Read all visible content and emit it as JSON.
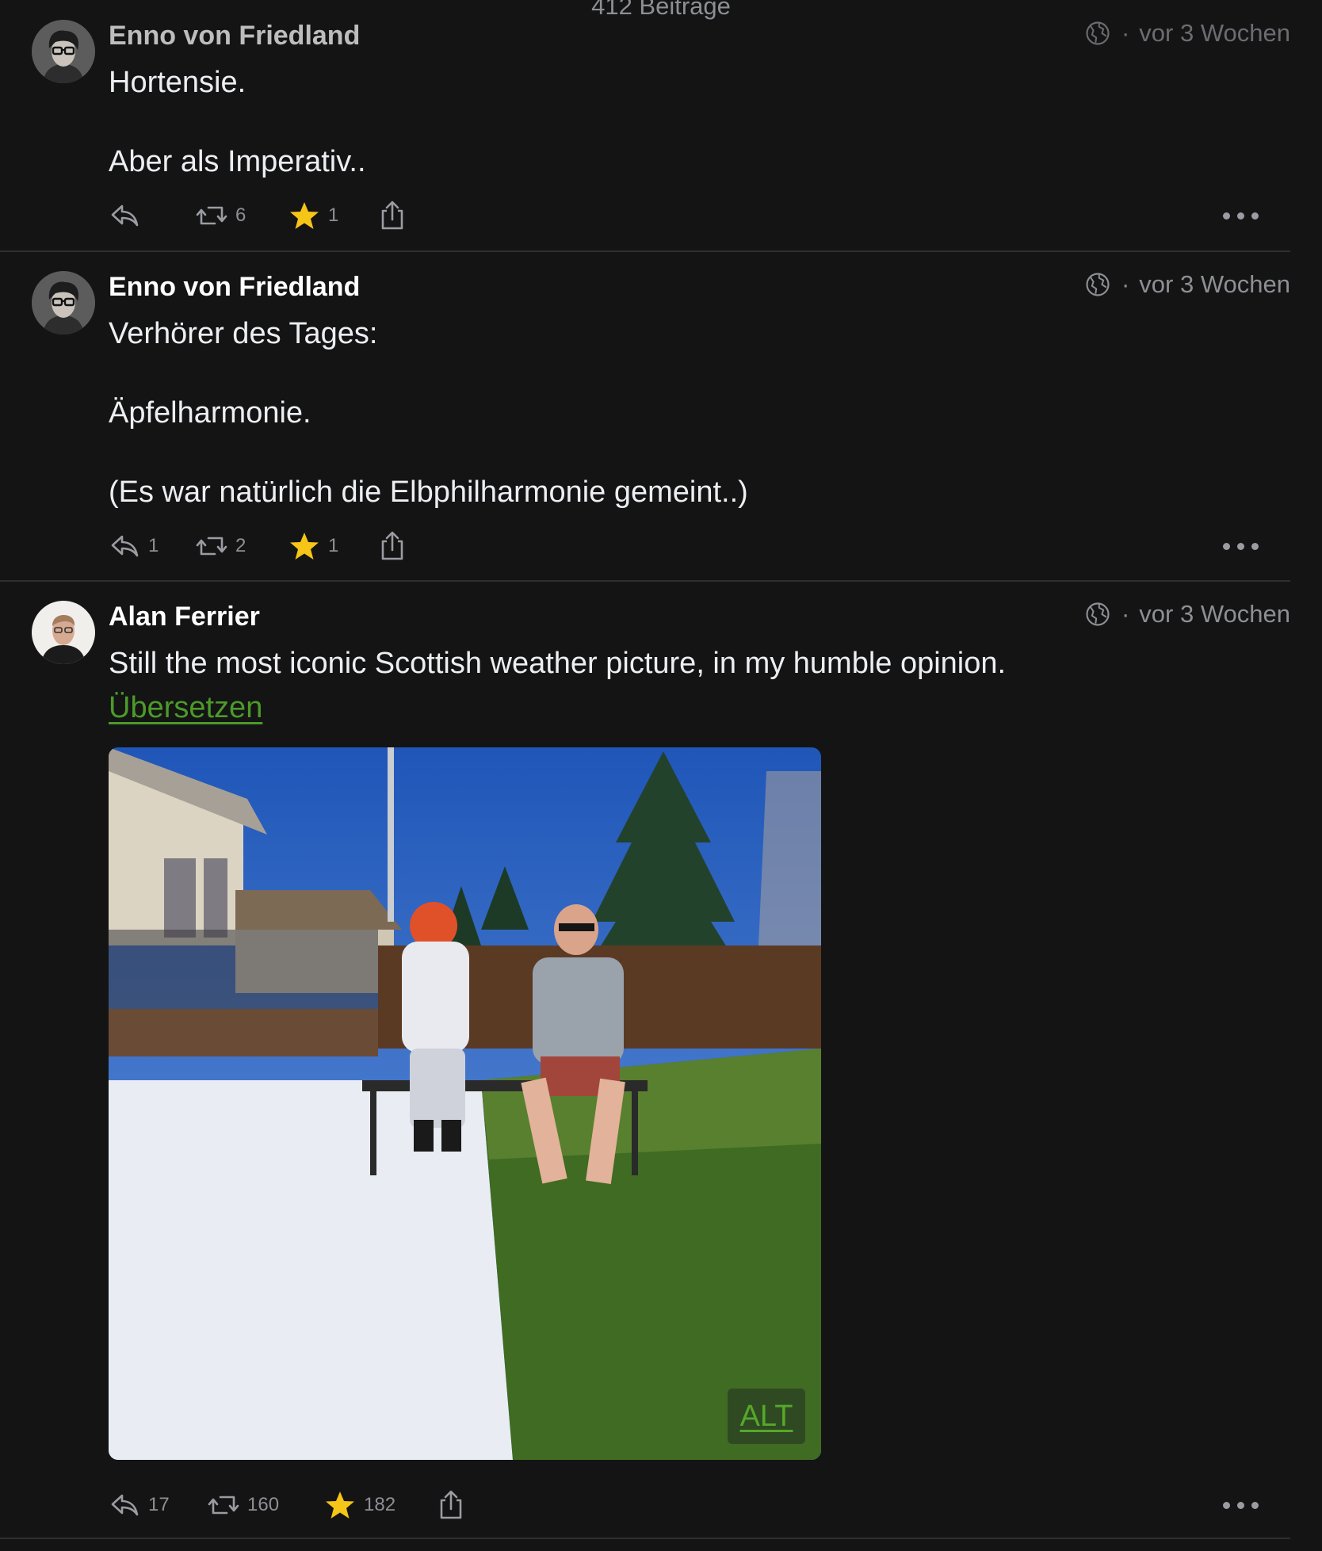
{
  "header": {
    "post_count": "412 Beiträge"
  },
  "posts": [
    {
      "author": "Enno von Friedland",
      "visibility_icon": "globe-icon",
      "time": "vor 3 Wochen",
      "paragraphs": [
        "Hortensie.",
        "Aber als Imperativ.."
      ],
      "replies": "",
      "boosts": "6",
      "favourites": "1"
    },
    {
      "author": "Enno von Friedland",
      "visibility_icon": "globe-icon",
      "time": "vor 3 Wochen",
      "paragraphs": [
        "Verhörer des Tages:",
        "Äpfelharmonie.",
        "(Es war natürlich die Elbphilharmonie gemeint..)"
      ],
      "replies": "1",
      "boosts": "2",
      "favourites": "1"
    },
    {
      "author": "Alan Ferrier",
      "visibility_icon": "globe-icon",
      "time": "vor 3 Wochen",
      "paragraphs": [
        "Still the most iconic Scottish weather picture, in my humble opinion."
      ],
      "translate_label": "Übersetzen",
      "media_alt_badge": "ALT",
      "replies": "17",
      "boosts": "160",
      "favourites": "182"
    }
  ],
  "colors": {
    "background": "#141414",
    "accent_green": "#4c9a2a",
    "star": "#f5c518",
    "muted": "#8d8f95"
  },
  "meta_separator": "·"
}
